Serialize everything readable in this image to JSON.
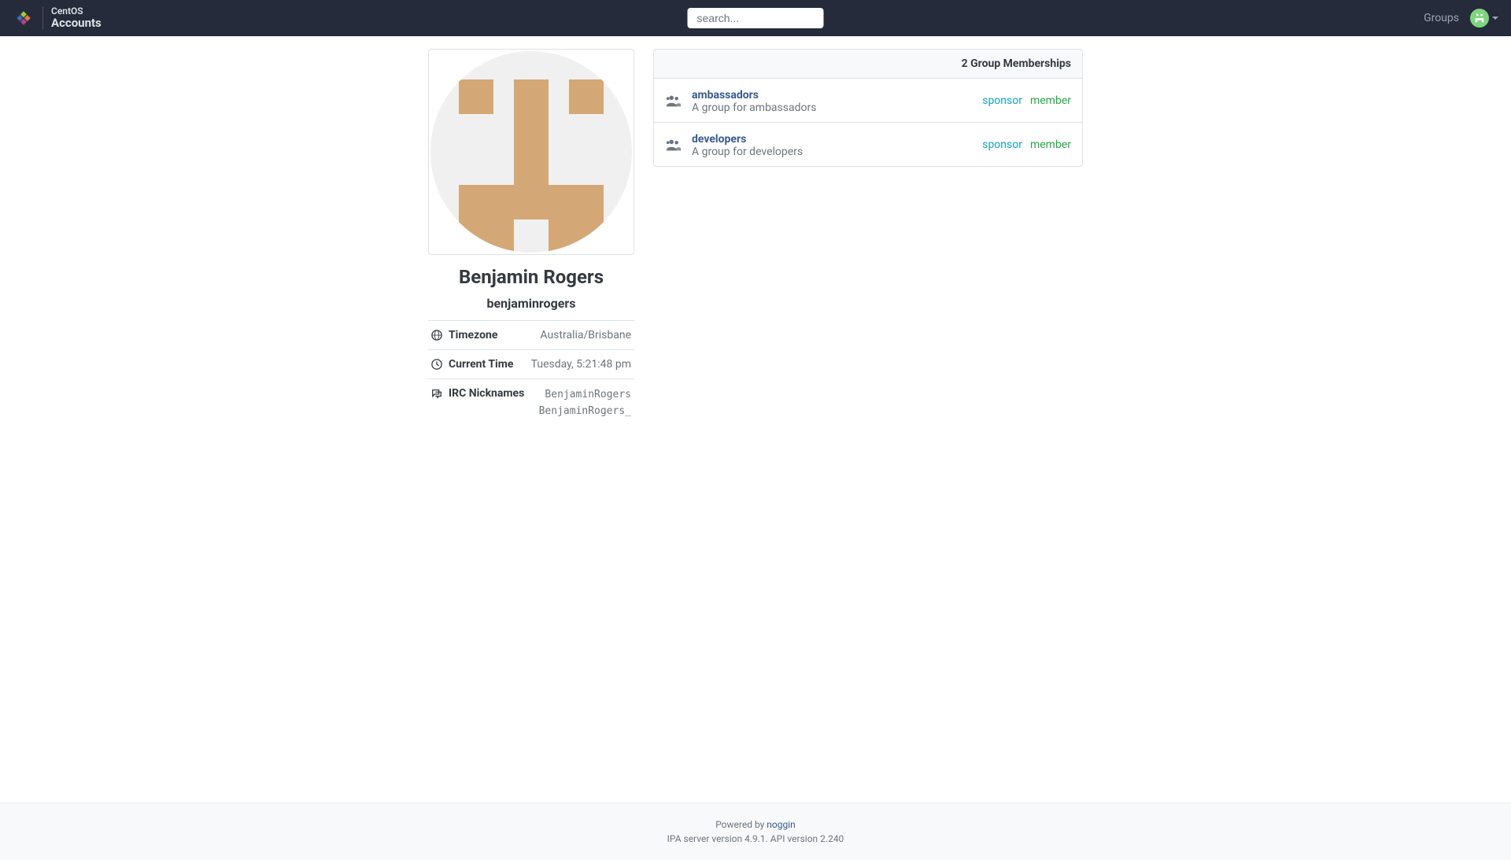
{
  "header": {
    "brand_line1": "CentOS",
    "brand_line2": "Accounts",
    "search_placeholder": "search...",
    "groups_link": "Groups"
  },
  "profile": {
    "display_name": "Benjamin Rogers",
    "username": "benjaminrogers",
    "info": {
      "timezone_label": "Timezone",
      "timezone_value": "Australia/Brisbane",
      "current_time_label": "Current Time",
      "current_time_value": "Tuesday, 5:21:48 pm",
      "irc_label": "IRC Nicknames",
      "irc_nick1": "BenjaminRogers",
      "irc_nick2": "BenjaminRogers_"
    }
  },
  "groups": {
    "header": "2 Group Memberships",
    "items": [
      {
        "name": "ambassadors",
        "desc": "A group for ambassadors",
        "role1": "sponsor",
        "role2": "member"
      },
      {
        "name": "developers",
        "desc": "A group for developers",
        "role1": "sponsor",
        "role2": "member"
      }
    ]
  },
  "footer": {
    "powered_by": "Powered by ",
    "powered_link": "noggin",
    "version": "IPA server version 4.9.1. API version 2.240"
  }
}
